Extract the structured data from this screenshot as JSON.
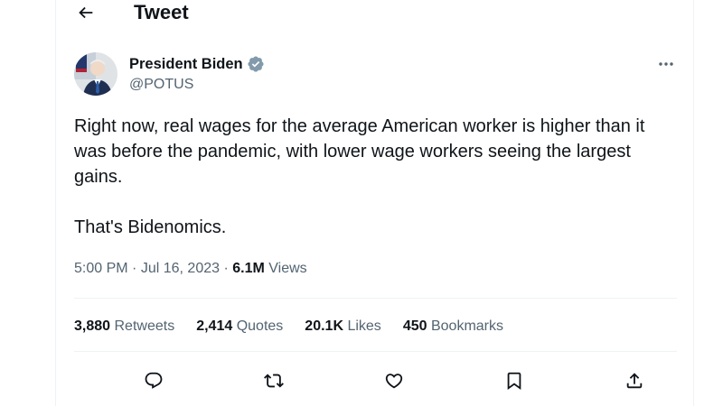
{
  "header": {
    "title": "Tweet",
    "back_icon": "arrow-left-icon"
  },
  "author": {
    "display_name": "President Biden",
    "handle": "@POTUS",
    "verified_badge_color": "#829aab",
    "more_icon": "ellipsis-icon"
  },
  "tweet": {
    "paragraphs": [
      "Right now, real wages for the average American worker is higher than it was before the pandemic, with lower wage workers seeing the largest gains.",
      "That's Bidenomics."
    ]
  },
  "meta": {
    "time": "5:00 PM",
    "separator": "·",
    "date": "Jul 16, 2023",
    "views_count": "6.1M",
    "views_label": "Views"
  },
  "stats": [
    {
      "count": "3,880",
      "label": "Retweets"
    },
    {
      "count": "2,414",
      "label": "Quotes"
    },
    {
      "count": "20.1K",
      "label": "Likes"
    },
    {
      "count": "450",
      "label": "Bookmarks"
    }
  ],
  "actions": [
    {
      "name": "reply",
      "icon": "reply-icon"
    },
    {
      "name": "retweet",
      "icon": "retweet-icon"
    },
    {
      "name": "like",
      "icon": "heart-icon"
    },
    {
      "name": "bookmark",
      "icon": "bookmark-icon"
    },
    {
      "name": "share",
      "icon": "share-icon"
    }
  ],
  "colors": {
    "text": "#0f1419",
    "secondary": "#536471",
    "divider": "#eff3f4"
  }
}
